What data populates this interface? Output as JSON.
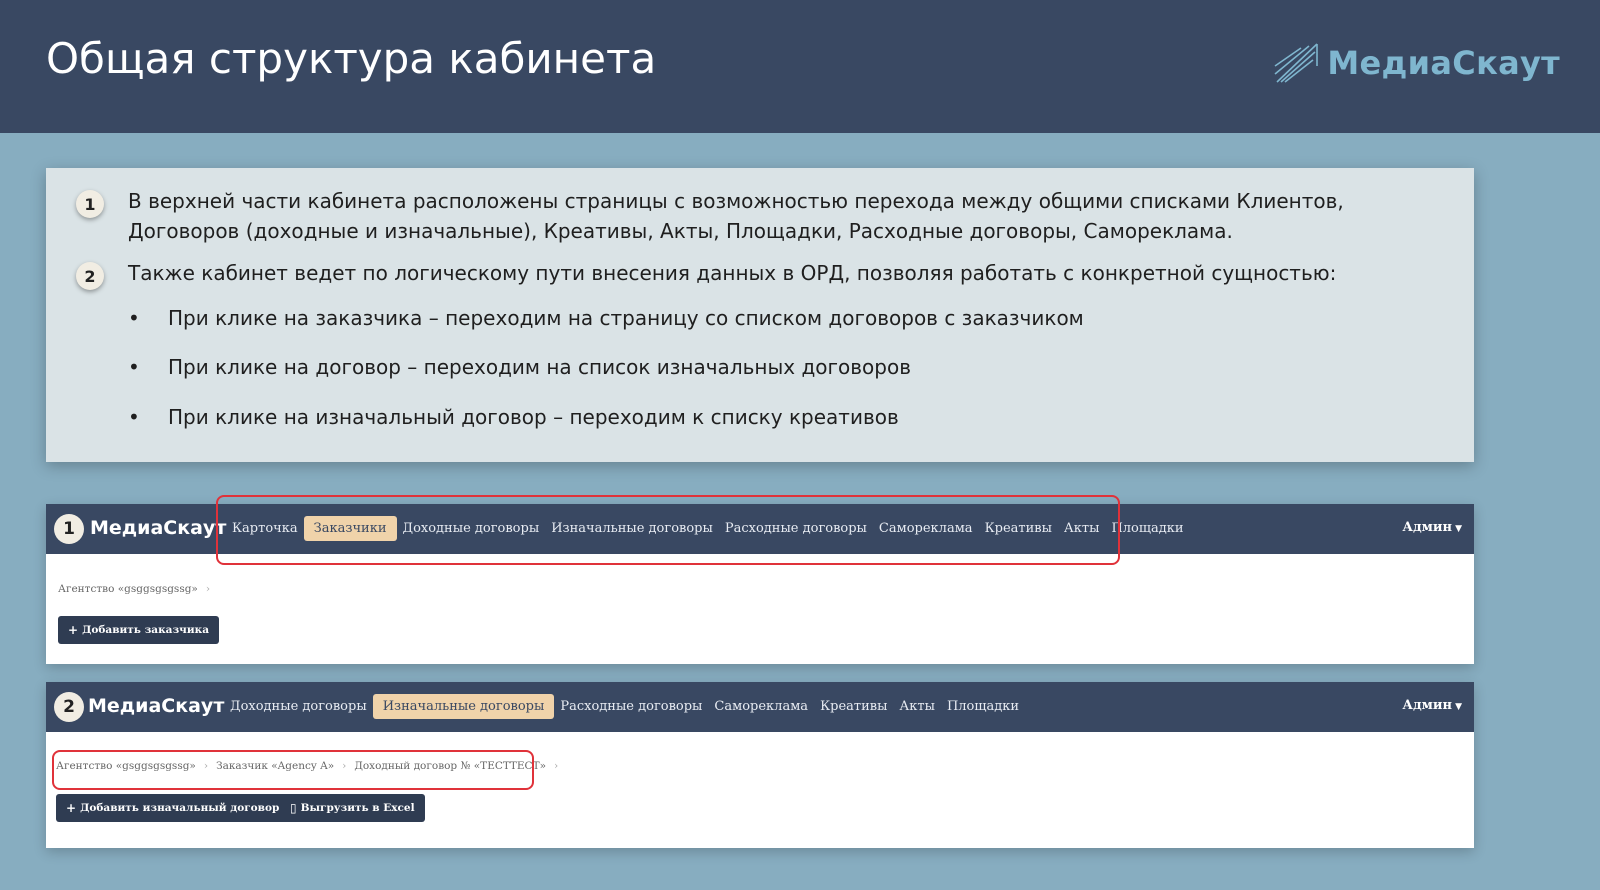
{
  "slide": {
    "title": "Общая структура кабинета",
    "brand": "МедиаСкаут"
  },
  "info": {
    "item1_number": "1",
    "item1_text": "В верхней части кабинета расположены страницы с возможностью перехода между общими списками Клиентов, Договоров (доходные и изначальные), Креативы, Акты, Площадки, Расходные договоры, Самореклама.",
    "item2_number": "2",
    "item2_text": "Также кабинет ведет по логическому пути внесения данных в ОРД, позволяя работать с конкретной сущностью:",
    "bullets": [
      "При клике на заказчика – переходим на страницу со списком договоров с заказчиком",
      "При клике на договор – переходим на список изначальных договоров",
      "При клике на изначальный договор – переходим к списку креативов"
    ]
  },
  "screen1": {
    "badge": "1",
    "brand": "МедиаСкаут",
    "nav": [
      "Карточка",
      "Заказчики",
      "Доходные договоры",
      "Изначальные договоры",
      "Расходные договоры",
      "Самореклама",
      "Креативы",
      "Акты",
      "Площадки"
    ],
    "active_nav": "Заказчики",
    "admin": "Админ",
    "breadcrumb": [
      "Агентство «gsggsgsgssg»"
    ],
    "add_button": "Добавить заказчика"
  },
  "screen2": {
    "badge": "2",
    "brand": "МедиаСкаут",
    "nav": [
      "Доходные договоры",
      "Изначальные договоры",
      "Расходные договоры",
      "Самореклама",
      "Креативы",
      "Акты",
      "Площадки"
    ],
    "active_nav": "Изначальные договоры",
    "admin": "Админ",
    "breadcrumb": [
      "Агентство «gsggsgsgssg»",
      "Заказчик «Agency A»",
      "Доходный договор № «ТЕСТТЕСТ»"
    ],
    "add_button": "Добавить изначальный договор",
    "export_button": "Выгрузить в Excel"
  },
  "colors": {
    "header_bg": "#394862",
    "slide_bg": "#87adc0",
    "card_bg": "#dae3e6",
    "active_tab": "#f0d3aa",
    "highlight": "#e0323a",
    "brand_text": "#7fb6cf"
  }
}
